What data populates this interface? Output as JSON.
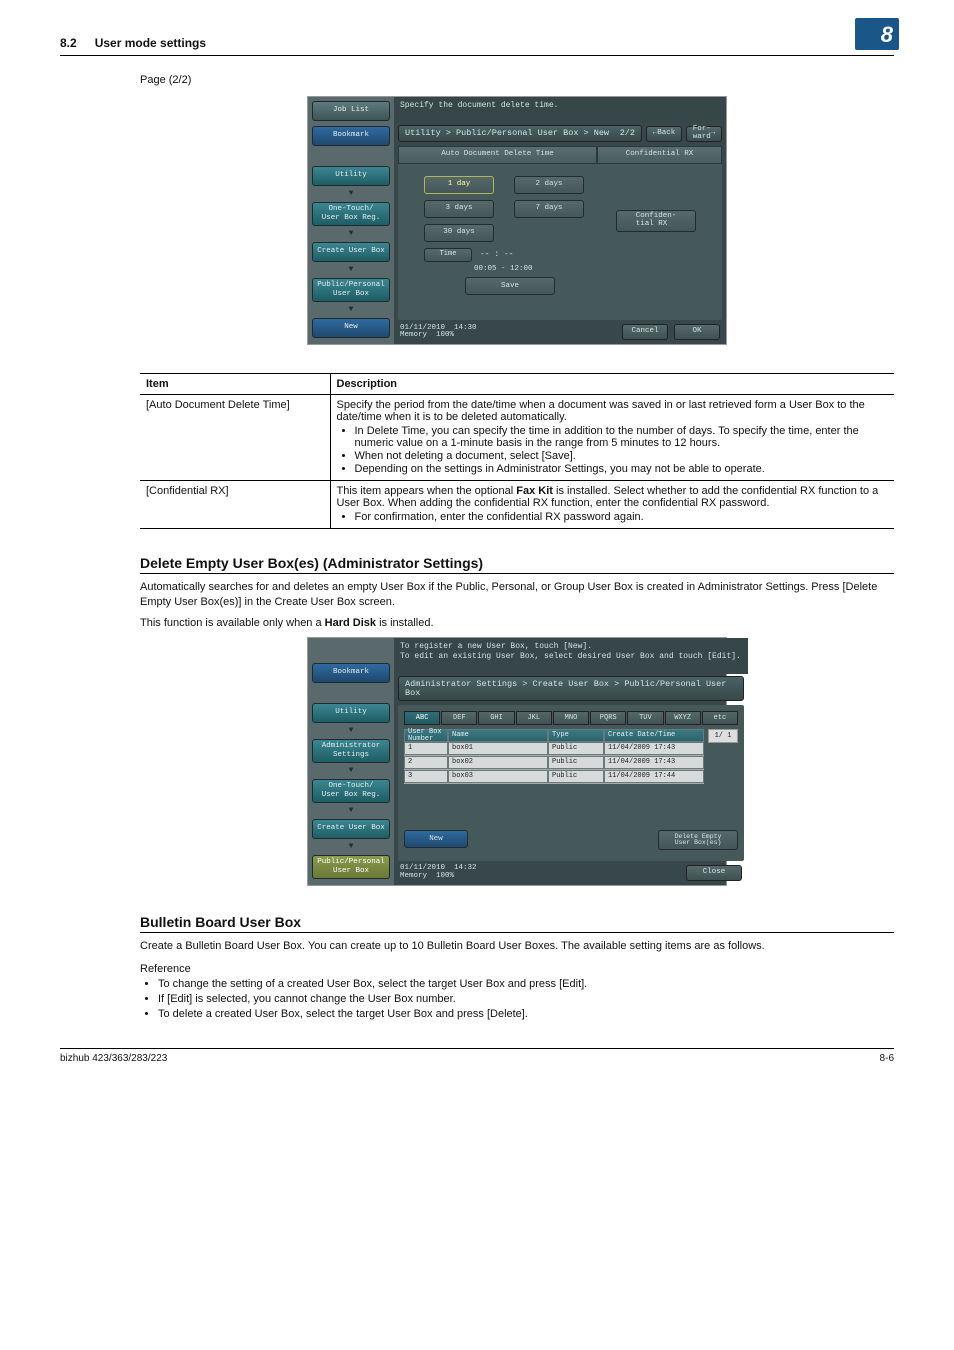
{
  "header": {
    "num": "8.2",
    "title": "User mode settings",
    "chapter": "8"
  },
  "page_label": "Page (2/2)",
  "panel1": {
    "side": {
      "job_list": "Job List",
      "bookmark": "Bookmark",
      "utility": "Utility",
      "one_touch": "One-Touch/\nUser Box Reg.",
      "create": "Create User Box",
      "pub": "Public/Personal\nUser Box",
      "new": "New"
    },
    "top_msg": "Specify the document delete time.",
    "breadcrumb": "Utility > Public/Personal User Box > New",
    "page_ind": "2/2",
    "back": "Back",
    "forward": "For-\nward",
    "tabs": {
      "t1": "Auto Document Delete Time",
      "t2": "Confidential RX"
    },
    "opts": {
      "d1": "1 day",
      "d2": "2 days",
      "d3": "3 days",
      "d7": "7 days",
      "d30": "30 days",
      "time": "Time",
      "time_val": "-- : --",
      "range": "00:05  -  12:00",
      "save": "Save"
    },
    "side_right": "Confiden-\ntial RX",
    "footer": {
      "date": "01/11/2010",
      "time": "14:30",
      "mem": "Memory",
      "memv": "100%",
      "cancel": "Cancel",
      "ok": "OK"
    }
  },
  "table": {
    "h1": "Item",
    "h2": "Description",
    "rows": [
      {
        "item": "[Auto Document Delete Time]",
        "desc": "Specify the period from the date/time when a document was saved in or last retrieved form a User Box to the date/time when it is to be deleted automatically.",
        "bullets": [
          "In Delete Time, you can specify the time in addition to the number of days. To specify the time, enter the numeric value on a 1-minute basis in the range from 5 minutes to 12 hours.",
          "When not deleting a document, select [Save].",
          "Depending on the settings in Administrator Settings, you may not be able to operate."
        ]
      },
      {
        "item": "[Confidential RX]",
        "desc_html": "This item appears when the optional <b>Fax Kit</b> is installed. Select whether to add the confidential RX function to a User Box. When adding the confidential RX function, enter the confidential RX password.",
        "bullets": [
          "For confirmation, enter the confidential RX password again."
        ]
      }
    ]
  },
  "sec1": {
    "title": "Delete Empty User Box(es) (Administrator Settings)",
    "p1": "Automatically searches for and deletes an empty User Box if the Public, Personal, or Group User Box is created in Administrator Settings. Press [Delete Empty User Box(es)] in the Create User Box screen.",
    "p2_pre": "This function is available only when a ",
    "p2_b": "Hard Disk",
    "p2_post": " is installed."
  },
  "panel2": {
    "top_msg": "To register a new User Box, touch [New].\nTo edit an existing User Box, select desired User Box and touch [Edit].",
    "breadcrumb": "Administrator Settings > Create User Box > Public/Personal User Box",
    "side": {
      "bookmark": "Bookmark",
      "utility": "Utility",
      "admin": "Administrator\nSettings",
      "one_touch": "One-Touch/\nUser Box Reg.",
      "create": "Create User Box",
      "pub": "Public/Personal\nUser Box"
    },
    "letters": [
      "ABC",
      "DEF",
      "GHI",
      "JKL",
      "MNO",
      "PQRS",
      "TUV",
      "WXYZ",
      "etc"
    ],
    "cols": {
      "no": "User Box\nNumber",
      "name": "Name",
      "type": "Type",
      "date": "Create Date/Time"
    },
    "rows": [
      {
        "no": "1",
        "name": "box01",
        "type": "Public",
        "date": "11/04/2009 17:43"
      },
      {
        "no": "2",
        "name": "box02",
        "type": "Public",
        "date": "11/04/2009 17:43"
      },
      {
        "no": "3",
        "name": "box03",
        "type": "Public",
        "date": "11/04/2009 17:44"
      }
    ],
    "paging": "1/  1",
    "new_btn": "New",
    "del_btn": "Delete Empty\nUser Box(es)",
    "footer": {
      "date": "01/11/2010",
      "time": "14:32",
      "mem": "Memory",
      "memv": "100%",
      "close": "Close"
    }
  },
  "sec2": {
    "title": "Bulletin Board User Box",
    "p1": "Create a Bulletin Board User Box. You can create up to 10 Bulletin Board User Boxes. The available setting items are as follows.",
    "ref": "Reference",
    "bullets": [
      "To change the setting of a created User Box, select the target User Box and press [Edit].",
      "If [Edit] is selected, you cannot change the User Box number.",
      "To delete a created User Box, select the target User Box and press [Delete]."
    ]
  },
  "footer": {
    "left": "bizhub 423/363/283/223",
    "right": "8-6"
  }
}
